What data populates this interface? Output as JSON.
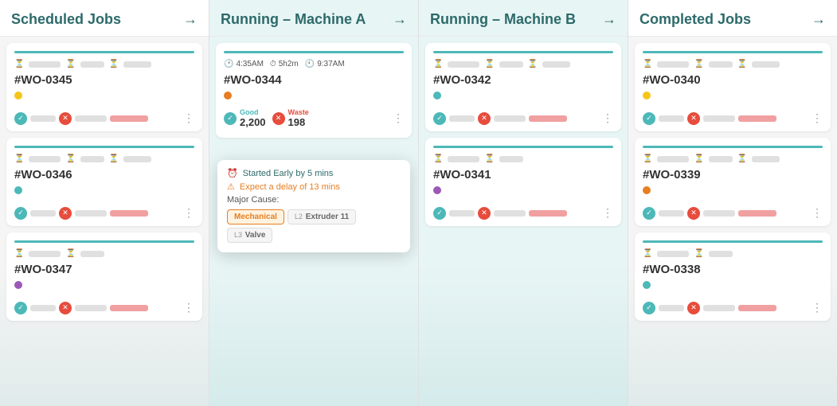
{
  "columns": [
    {
      "id": "scheduled",
      "title": "Scheduled Jobs",
      "arrow": "→",
      "cards": [
        {
          "id": "wo-0345",
          "wo": "#WO-0345",
          "dot": "yellow",
          "top_bar_color": "#4db8b8"
        },
        {
          "id": "wo-0346",
          "wo": "#WO-0346",
          "dot": "green",
          "top_bar_color": "#4db8b8"
        },
        {
          "id": "wo-0347",
          "wo": "#WO-0347",
          "dot": "purple",
          "top_bar_color": "#4db8b8"
        }
      ]
    },
    {
      "id": "running-a",
      "title": "Running – Machine A",
      "arrow": "→",
      "cards": [
        {
          "id": "wo-0344",
          "wo": "#WO-0344",
          "dot": "orange",
          "times": [
            "4:35AM",
            "5h2m",
            "9:37AM"
          ],
          "good": "2,200",
          "waste": "198",
          "top_bar_color": "#4db8b8",
          "has_popup": true
        }
      ],
      "popup": {
        "started_early": "Started Early by 5 mins",
        "expect_delay": "Expect a delay of 13 mins",
        "cause_label": "Major Cause:",
        "tags": [
          {
            "label": "",
            "value": "Mechanical",
            "style": "orange"
          },
          {
            "label": "L2",
            "value": "Extruder 11",
            "style": "gray"
          },
          {
            "label": "L3",
            "value": "Valve",
            "style": "gray"
          }
        ]
      }
    },
    {
      "id": "running-b",
      "title": "Running – Machine B",
      "arrow": "→",
      "cards": [
        {
          "id": "wo-0342",
          "wo": "#WO-0342",
          "dot": "green",
          "top_bar_color": "#4db8b8"
        },
        {
          "id": "wo-0341",
          "wo": "#WO-0341",
          "dot": "purple",
          "top_bar_color": "#4db8b8"
        }
      ]
    },
    {
      "id": "completed",
      "title": "Completed Jobs",
      "arrow": "→",
      "cards": [
        {
          "id": "wo-0340",
          "wo": "#WO-0340",
          "dot": "yellow",
          "top_bar_color": "#4db8b8"
        },
        {
          "id": "wo-0339",
          "wo": "#WO-0339",
          "dot": "orange",
          "top_bar_color": "#4db8b8"
        },
        {
          "id": "wo-0338",
          "wo": "#WO-0338",
          "dot": "green",
          "top_bar_color": "#4db8b8"
        }
      ]
    }
  ]
}
